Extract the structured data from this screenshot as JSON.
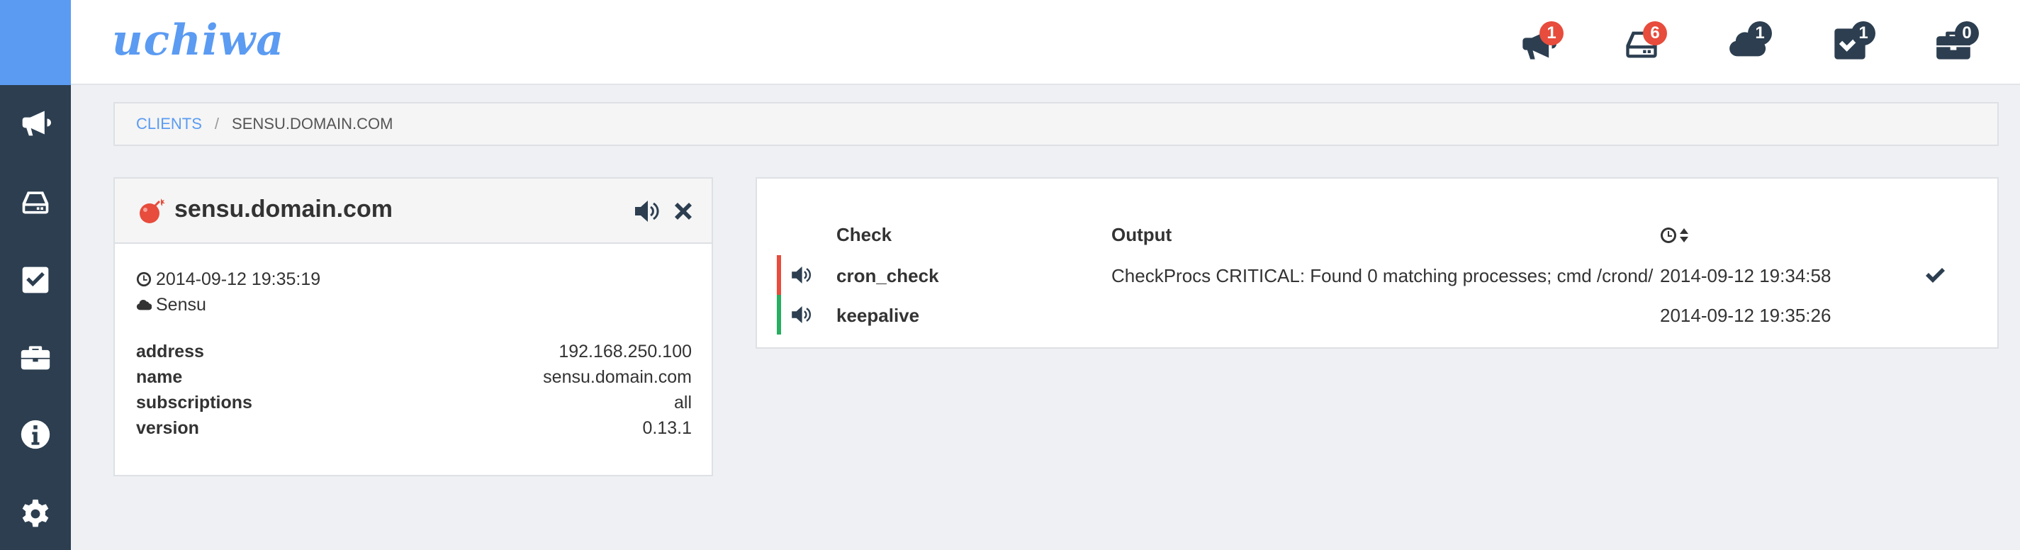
{
  "app": {
    "brand": "uchiwa",
    "accent_color": "#5b9bf2",
    "sidebar_color": "#2c3e50"
  },
  "sidebar": {
    "items": [
      {
        "icon": "megaphone-icon",
        "label": "Events"
      },
      {
        "icon": "drive-icon",
        "label": "Clients"
      },
      {
        "icon": "checkbox-icon",
        "label": "Checks"
      },
      {
        "icon": "briefcase-icon",
        "label": "Stashes"
      },
      {
        "icon": "info-icon",
        "label": "Info"
      },
      {
        "icon": "gear-icon",
        "label": "Settings"
      }
    ]
  },
  "topbar": {
    "indicators": [
      {
        "icon": "megaphone-icon",
        "count": "1",
        "color": "#e74c3c"
      },
      {
        "icon": "drive-icon",
        "count": "6",
        "color": "#e74c3c"
      },
      {
        "icon": "cloud-icon",
        "count": "1",
        "color": "#2c3e50"
      },
      {
        "icon": "checkbox-icon",
        "count": "1",
        "color": "#2c3e50"
      },
      {
        "icon": "briefcase-icon",
        "count": "0",
        "color": "#2c3e50"
      }
    ]
  },
  "breadcrumb": {
    "link": "CLIENTS",
    "separator": "/",
    "current": "SENSU.DOMAIN.COM"
  },
  "client": {
    "name": "sensu.domain.com",
    "status_color": "#e74c3c",
    "last_seen": "2014-09-12 19:35:19",
    "datacenter": "Sensu",
    "attributes": [
      {
        "key": "address",
        "value": "192.168.250.100"
      },
      {
        "key": "name",
        "value": "sensu.domain.com"
      },
      {
        "key": "subscriptions",
        "value": "all"
      },
      {
        "key": "version",
        "value": "0.13.1"
      }
    ]
  },
  "checks": {
    "headers": {
      "check": "Check",
      "output": "Output"
    },
    "rows": [
      {
        "name": "cron_check",
        "output": "CheckProcs CRITICAL: Found 0 matching processes; cmd /crond/",
        "timestamp": "2014-09-12 19:34:58",
        "status_color": "#e74c3c",
        "resolvable": true
      },
      {
        "name": "keepalive",
        "output": "",
        "timestamp": "2014-09-12 19:35:26",
        "status_color": "#27ae60",
        "resolvable": false
      }
    ]
  }
}
